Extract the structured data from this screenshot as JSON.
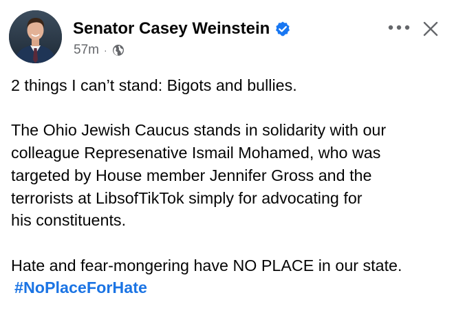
{
  "post": {
    "author": {
      "name": "Senator Casey Weinstein",
      "verified": true,
      "verified_color": "#1877f2",
      "avatar_icon": "profile-photo"
    },
    "meta": {
      "time": "57m",
      "separator": "·",
      "audience_icon": "globe-icon"
    },
    "actions": {
      "more_icon": "more-dots-icon",
      "close_icon": "close-icon"
    },
    "body": {
      "paragraph_1": "2 things I can’t stand: Bigots and bullies.",
      "paragraph_2_lines": [
        "The Ohio Jewish Caucus stands in solidarity with our",
        "colleague Represenative Ismail Mohamed, who was",
        "targeted by House member Jennifer Gross and the",
        "terrorists at LibsofTikTok simply for advocating for",
        "his constituents."
      ],
      "paragraph_3": "Hate and fear-mongering have NO PLACE in our state.",
      "hashtag": "#NoPlaceForHate",
      "hashtag_color": "#1b74e4"
    }
  }
}
